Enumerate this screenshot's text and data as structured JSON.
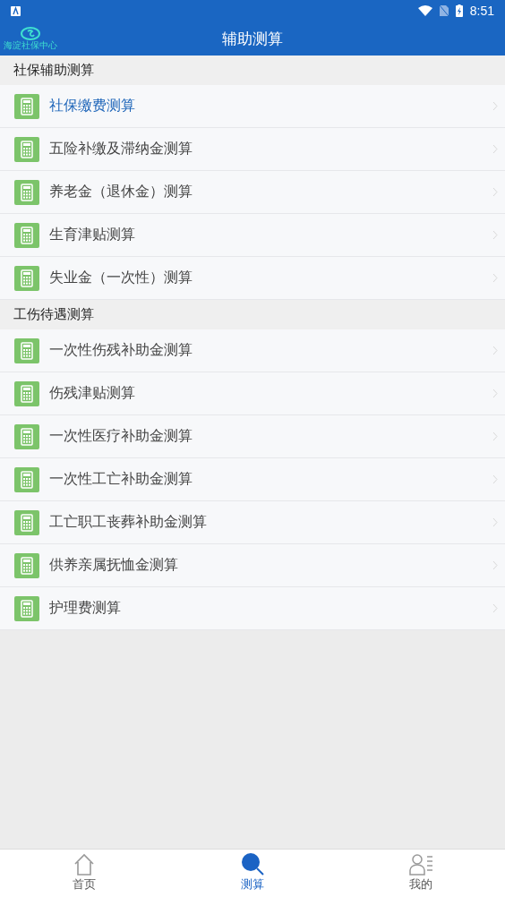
{
  "status_bar": {
    "time": "8:51"
  },
  "app_bar": {
    "logo_text": "海淀社保中心",
    "title": "辅助测算"
  },
  "sections": [
    {
      "title": "社保辅助测算",
      "items": [
        {
          "label": "社保缴费测算",
          "selected": true
        },
        {
          "label": "五险补缴及滞纳金测算",
          "selected": false
        },
        {
          "label": "养老金（退休金）测算",
          "selected": false
        },
        {
          "label": "生育津贴测算",
          "selected": false
        },
        {
          "label": "失业金（一次性）测算",
          "selected": false
        }
      ]
    },
    {
      "title": "工伤待遇测算",
      "items": [
        {
          "label": "一次性伤残补助金测算",
          "selected": false
        },
        {
          "label": "伤残津贴测算",
          "selected": false
        },
        {
          "label": "一次性医疗补助金测算",
          "selected": false
        },
        {
          "label": "一次性工亡补助金测算",
          "selected": false
        },
        {
          "label": "工亡职工丧葬补助金测算",
          "selected": false
        },
        {
          "label": "供养亲属抚恤金测算",
          "selected": false
        },
        {
          "label": "护理费测算",
          "selected": false
        }
      ]
    }
  ],
  "tabs": [
    {
      "kind": "home",
      "label": "首页",
      "selected": false
    },
    {
      "kind": "search",
      "label": "测算",
      "selected": true
    },
    {
      "kind": "profile",
      "label": "我的",
      "selected": false
    }
  ]
}
